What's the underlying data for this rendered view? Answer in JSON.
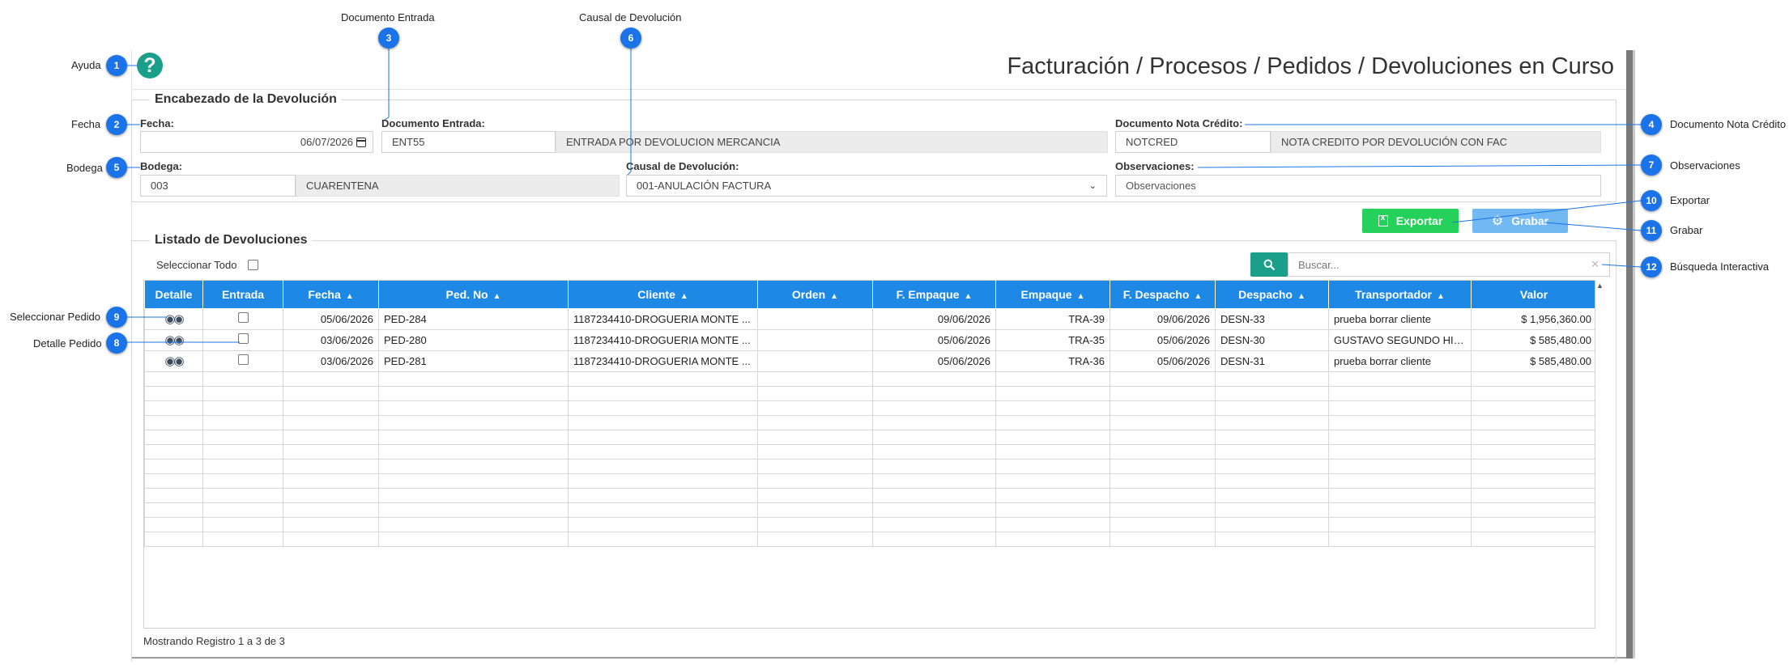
{
  "annotations": {
    "ayuda": {
      "num": "1",
      "label": "Ayuda"
    },
    "fecha": {
      "num": "2",
      "label": "Fecha"
    },
    "documento_entrada": {
      "num": "3",
      "label": "Documento Entrada"
    },
    "documento_nota_credito": {
      "num": "4",
      "label": "Documento Nota Crédito"
    },
    "bodega": {
      "num": "5",
      "label": "Bodega"
    },
    "causal_devolucion": {
      "num": "6",
      "label": "Causal de Devolución"
    },
    "observaciones": {
      "num": "7",
      "label": "Observaciones"
    },
    "detalle_pedido": {
      "num": "8",
      "label": "Detalle Pedido"
    },
    "seleccionar_pedido": {
      "num": "9",
      "label": "Seleccionar Pedido"
    },
    "exportar": {
      "num": "10",
      "label": "Exportar"
    },
    "grabar": {
      "num": "11",
      "label": "Grabar"
    },
    "busqueda": {
      "num": "12",
      "label": "Búsqueda Interactiva"
    }
  },
  "header": {
    "help_icon": "question-circle-icon",
    "title": "Facturación / Procesos / Pedidos / Devoluciones en Curso"
  },
  "encabezado": {
    "legend": "Encabezado de la Devolución",
    "fecha_label": "Fecha:",
    "fecha_value": "06/07/2026",
    "doc_entrada_label": "Documento Entrada:",
    "doc_entrada_code": "ENT55",
    "doc_entrada_desc": "ENTRADA POR DEVOLUCION MERCANCIA",
    "doc_nota_label": "Documento Nota Crédito:",
    "doc_nota_code": "NOTCRED",
    "doc_nota_desc": "NOTA CREDITO POR DEVOLUCIÓN CON FAC",
    "bodega_label": "Bodega:",
    "bodega_code": "003",
    "bodega_desc": "CUARENTENA",
    "causal_label": "Causal de Devolución:",
    "causal_value": "001-ANULACIÓN FACTURA",
    "obs_label": "Observaciones:",
    "obs_value": "Observaciones"
  },
  "actions": {
    "exportar_label": "Exportar",
    "grabar_label": "Grabar",
    "exportar_color": "#26d15b",
    "grabar_color": "#72b8f2"
  },
  "listado": {
    "legend": "Listado de Devoluciones",
    "select_all_label": "Seleccionar Todo",
    "search_placeholder": "Buscar...",
    "columns": [
      "Detalle",
      "Entrada",
      "Fecha",
      "Ped. No",
      "Cliente",
      "Orden",
      "F. Empaque",
      "Empaque",
      "F. Despacho",
      "Despacho",
      "Transportador",
      "Valor"
    ],
    "rows": [
      {
        "fecha": "05/06/2026",
        "ped": "PED-284",
        "cliente": "1187234410-DROGUERIA MONTE ...",
        "orden": "",
        "f_empaque": "09/06/2026",
        "empaque": "TRA-39",
        "f_despacho": "09/06/2026",
        "despacho": "DESN-33",
        "transportador": "prueba borrar cliente",
        "valor": "$ 1,956,360.00"
      },
      {
        "fecha": "03/06/2026",
        "ped": "PED-280",
        "cliente": "1187234410-DROGUERIA MONTE ...",
        "orden": "",
        "f_empaque": "05/06/2026",
        "empaque": "TRA-35",
        "f_despacho": "05/06/2026",
        "despacho": "DESN-30",
        "transportador": "GUSTAVO SEGUNDO HIG...",
        "valor": "$ 585,480.00"
      },
      {
        "fecha": "03/06/2026",
        "ped": "PED-281",
        "cliente": "1187234410-DROGUERIA MONTE ...",
        "orden": "",
        "f_empaque": "05/06/2026",
        "empaque": "TRA-36",
        "f_despacho": "05/06/2026",
        "despacho": "DESN-31",
        "transportador": "prueba borrar cliente",
        "valor": "$ 585,480.00"
      }
    ],
    "footer": "Mostrando Registro 1 a 3 de 3"
  },
  "colors": {
    "accent": "#1e88e5",
    "teal": "#1aa08a",
    "badge": "#1a73e8"
  }
}
